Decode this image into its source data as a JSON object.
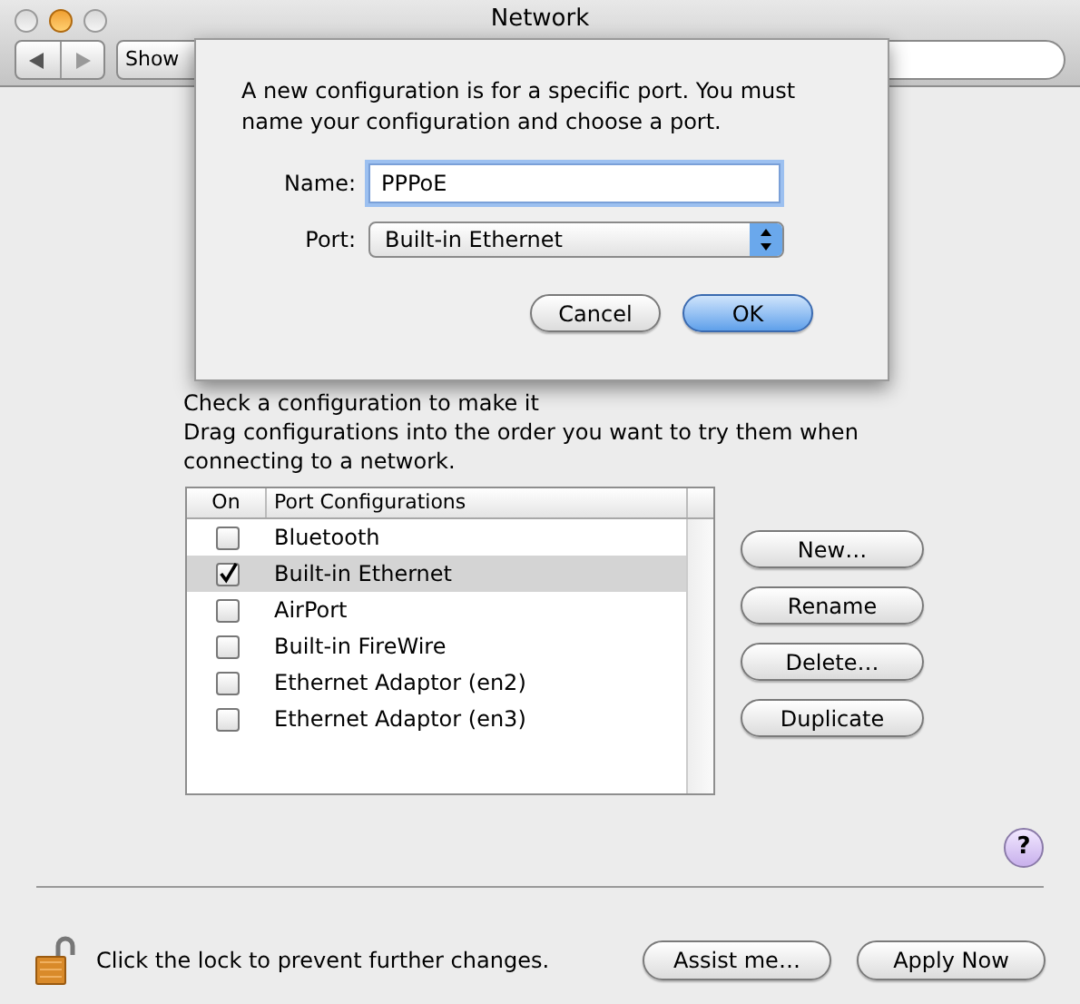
{
  "window": {
    "title": "Network"
  },
  "toolbar": {
    "show_all_button": "Show"
  },
  "help_button": "?",
  "sheet": {
    "message": "A new configuration is for a specific port. You must name your configuration and choose a port.",
    "name_label": "Name:",
    "name_value": "PPPoE",
    "port_label": "Port:",
    "port_value": "Built-in Ethernet",
    "buttons": [
      {
        "label": "Cancel",
        "default": false
      },
      {
        "label": "OK",
        "default": true
      }
    ]
  },
  "instructions": [
    "Check a configuration to make it",
    "Drag configurations into the order you want to try them when",
    "connecting to a network."
  ],
  "table": {
    "columns": [
      "On",
      "Port Configurations"
    ],
    "rows": [
      {
        "name": "Bluetooth",
        "checked": false,
        "selected": false
      },
      {
        "name": "Built-in Ethernet",
        "checked": true,
        "selected": true
      },
      {
        "name": "AirPort",
        "checked": false,
        "selected": false
      },
      {
        "name": "Built-in FireWire",
        "checked": false,
        "selected": false
      },
      {
        "name": "Ethernet Adaptor (en2)",
        "checked": false,
        "selected": false
      },
      {
        "name": "Ethernet Adaptor (en3)",
        "checked": false,
        "selected": false
      }
    ]
  },
  "side_buttons": [
    "New…",
    "Rename",
    "Delete…",
    "Duplicate"
  ],
  "footer": {
    "lock_text": "Click the lock to prevent further changes.",
    "buttons": [
      "Assist me…",
      "Apply Now"
    ]
  }
}
